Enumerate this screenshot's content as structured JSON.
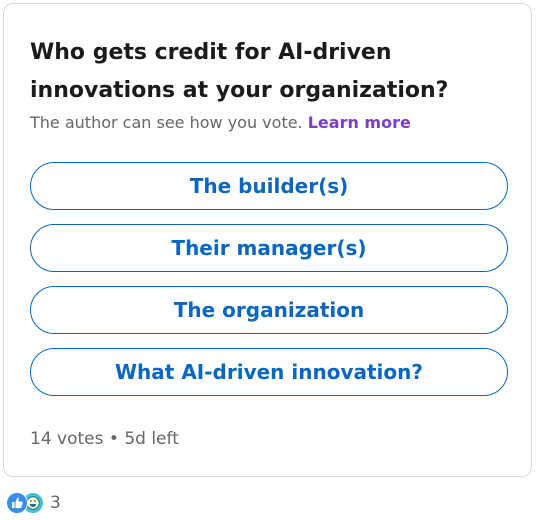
{
  "poll": {
    "question": "Who gets credit for AI-driven innovations at your organization?",
    "author_note": "The author can see how you vote.",
    "learn_more_label": "Learn more",
    "options": [
      {
        "label": "The builder(s)"
      },
      {
        "label": "Their manager(s)"
      },
      {
        "label": "The organization"
      },
      {
        "label": "What AI-driven innovation?"
      }
    ],
    "votes": "14 votes",
    "separator": "•",
    "time_left": "5d left"
  },
  "social": {
    "reaction_icons": [
      "like-icon",
      "funny-icon"
    ],
    "reaction_count": "3"
  },
  "colors": {
    "accent": "#0a66c2",
    "link_purple": "#7b3fc4",
    "muted_text": "#666666",
    "border": "#d9d9d9"
  }
}
